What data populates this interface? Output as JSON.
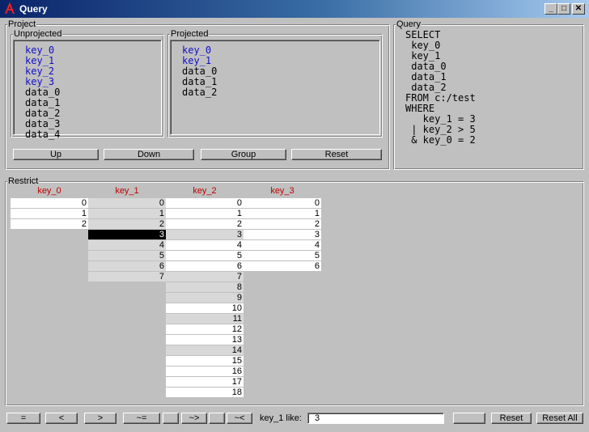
{
  "window": {
    "title": "Query",
    "buttons": {
      "minimize": "_",
      "maximize": "□",
      "close": "✕"
    }
  },
  "project": {
    "label": "Project",
    "unprojected": {
      "label": "Unprojected",
      "items": [
        {
          "text": "key_0",
          "projected": true
        },
        {
          "text": "key_1",
          "projected": true
        },
        {
          "text": "key_2",
          "projected": true
        },
        {
          "text": "key_3",
          "projected": true
        },
        {
          "text": "data_0",
          "projected": false
        },
        {
          "text": "data_1",
          "projected": false
        },
        {
          "text": "data_2",
          "projected": false
        },
        {
          "text": "data_3",
          "projected": false
        },
        {
          "text": "data_4",
          "projected": false
        }
      ]
    },
    "projected": {
      "label": "Projected",
      "items": [
        {
          "text": "key_0",
          "projected": true
        },
        {
          "text": "key_1",
          "projected": true
        },
        {
          "text": "data_0",
          "projected": false
        },
        {
          "text": "data_1",
          "projected": false
        },
        {
          "text": "data_2",
          "projected": false
        }
      ]
    },
    "buttons": {
      "up": "Up",
      "down": "Down",
      "group": "Group",
      "reset": "Reset"
    }
  },
  "query": {
    "label": "Query",
    "lines": [
      "SELECT",
      " key_0",
      " key_1",
      " data_0",
      " data_1",
      " data_2",
      "FROM c:/test",
      "WHERE",
      "   key_1 = 3",
      " | key_2 > 5",
      " & key_0 = 2"
    ]
  },
  "restrict": {
    "label": "Restrict",
    "columns": [
      {
        "name": "key_0",
        "values": [
          "0",
          "1",
          "2"
        ],
        "filtered": [],
        "selected": null
      },
      {
        "name": "key_1",
        "values": [
          "0",
          "1",
          "2",
          "3",
          "4",
          "5",
          "6",
          "7"
        ],
        "filtered": [
          "0",
          "1",
          "2",
          "3",
          "4",
          "5",
          "6",
          "7"
        ],
        "selected": "3"
      },
      {
        "name": "key_2",
        "values": [
          "0",
          "1",
          "2",
          "3",
          "4",
          "5",
          "6",
          "7",
          "8",
          "9",
          "10",
          "11",
          "12",
          "13",
          "14",
          "15",
          "16",
          "17",
          "18"
        ],
        "filtered": [
          "3",
          "7",
          "8",
          "9",
          "11",
          "14"
        ],
        "selected": null
      },
      {
        "name": "key_3",
        "values": [
          "0",
          "1",
          "2",
          "3",
          "4",
          "5",
          "6"
        ],
        "filtered": [],
        "selected": null
      }
    ]
  },
  "bottom": {
    "ops": [
      "=",
      "<",
      ">",
      "~=",
      "",
      "~>",
      "",
      "~<"
    ],
    "like_label": "key_1 like:",
    "like_value": "3",
    "blank_button": "",
    "reset": "Reset",
    "reset_all": "Reset All"
  },
  "colors": {
    "face": "#c0c0c0",
    "projected_text": "#1010c8",
    "column_header": "#c00000",
    "title_start": "#0a246a",
    "title_end": "#a6caf0"
  }
}
